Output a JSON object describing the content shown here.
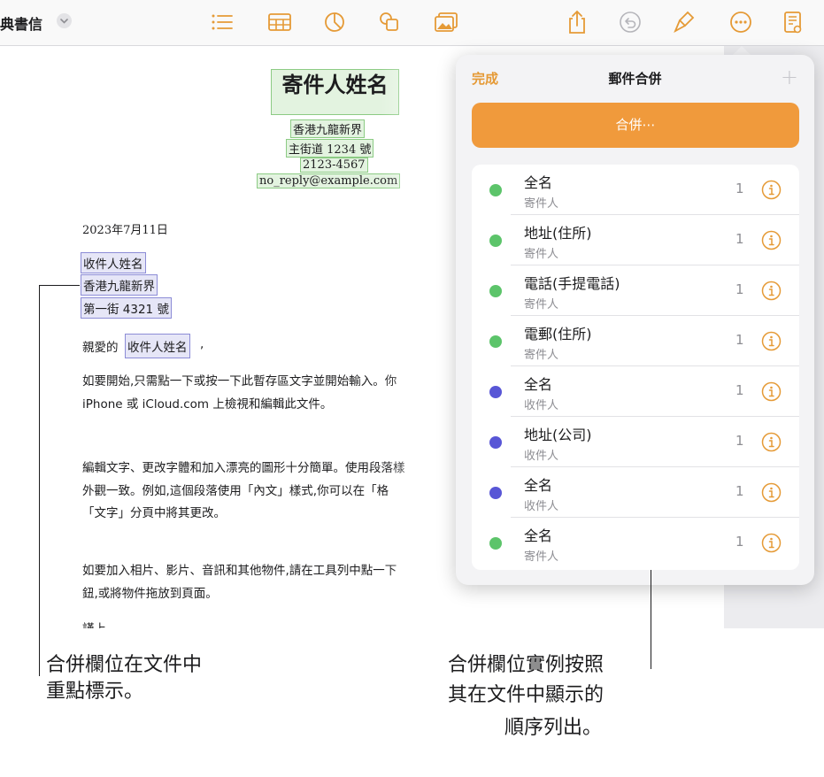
{
  "toolbar": {
    "doc_title": "典書信",
    "icons": [
      "chevron-down-icon",
      "list-icon",
      "table-icon",
      "chart-icon",
      "shape-icon",
      "media-icon",
      "share-icon",
      "undo-icon",
      "brush-icon",
      "more-icon",
      "document-view-icon"
    ],
    "accent": "#e59a36"
  },
  "document": {
    "sender_name": "寄件人姓名",
    "sender_address1": "香港九龍新界",
    "sender_address2": "主街道 1234 號",
    "sender_phone": "2123-4567",
    "sender_email": "no_reply@example.com",
    "date": "2023年7月11日",
    "recipient_name": "收件人姓名",
    "recipient_address1": "香港九龍新界",
    "recipient_address2": "第一街 4321 號",
    "greeting_prefix": "親愛的",
    "greeting_name": "收件人姓名",
    "greeting_suffix": ",",
    "para1_line1": "如要開始,只需點一下或按一下此暫存區文字並開始輸入。你",
    "para1_line2": "iPhone 或 iCloud.com 上檢視和編輯此文件。",
    "para2_line1": "編輯文字、更改字體和加入漂亮的圖形十分簡單。使用段落樣",
    "para2_line2": "外觀一致。例如,這個段落使用「內文」樣式,你可以在「格",
    "para2_line3": "「文字」分頁中將其更改。",
    "para3_line1": "如要加入相片、影片、音訊和其他物件,請在工具列中點一下",
    "para3_line2": "鈕,或將物件拖放到頁面。",
    "closing": "謹上,"
  },
  "popover": {
    "done_label": "完成",
    "title": "郵件合併",
    "add_label": "+",
    "merge_button_label": "合併⋯",
    "fields": [
      {
        "name": "全名",
        "source": "寄件人",
        "count": "1",
        "color": "#5cc46a"
      },
      {
        "name": "地址(住所)",
        "source": "寄件人",
        "count": "1",
        "color": "#5cc46a"
      },
      {
        "name": "電話(手提電話)",
        "source": "寄件人",
        "count": "1",
        "color": "#5cc46a"
      },
      {
        "name": "電郵(住所)",
        "source": "寄件人",
        "count": "1",
        "color": "#5cc46a"
      },
      {
        "name": "全名",
        "source": "收件人",
        "count": "1",
        "color": "#5856d6"
      },
      {
        "name": "地址(公司)",
        "source": "收件人",
        "count": "1",
        "color": "#5856d6"
      },
      {
        "name": "全名",
        "source": "收件人",
        "count": "1",
        "color": "#5856d6"
      },
      {
        "name": "全名",
        "source": "寄件人",
        "count": "1",
        "color": "#5cc46a"
      }
    ]
  },
  "callouts": {
    "left_line1": "合併欄位在文件中",
    "left_line2": "重點標示。",
    "right_line1": "合併欄位實例按照",
    "right_line2": "其在文件中顯示的",
    "right_line3": "順序列出。"
  }
}
